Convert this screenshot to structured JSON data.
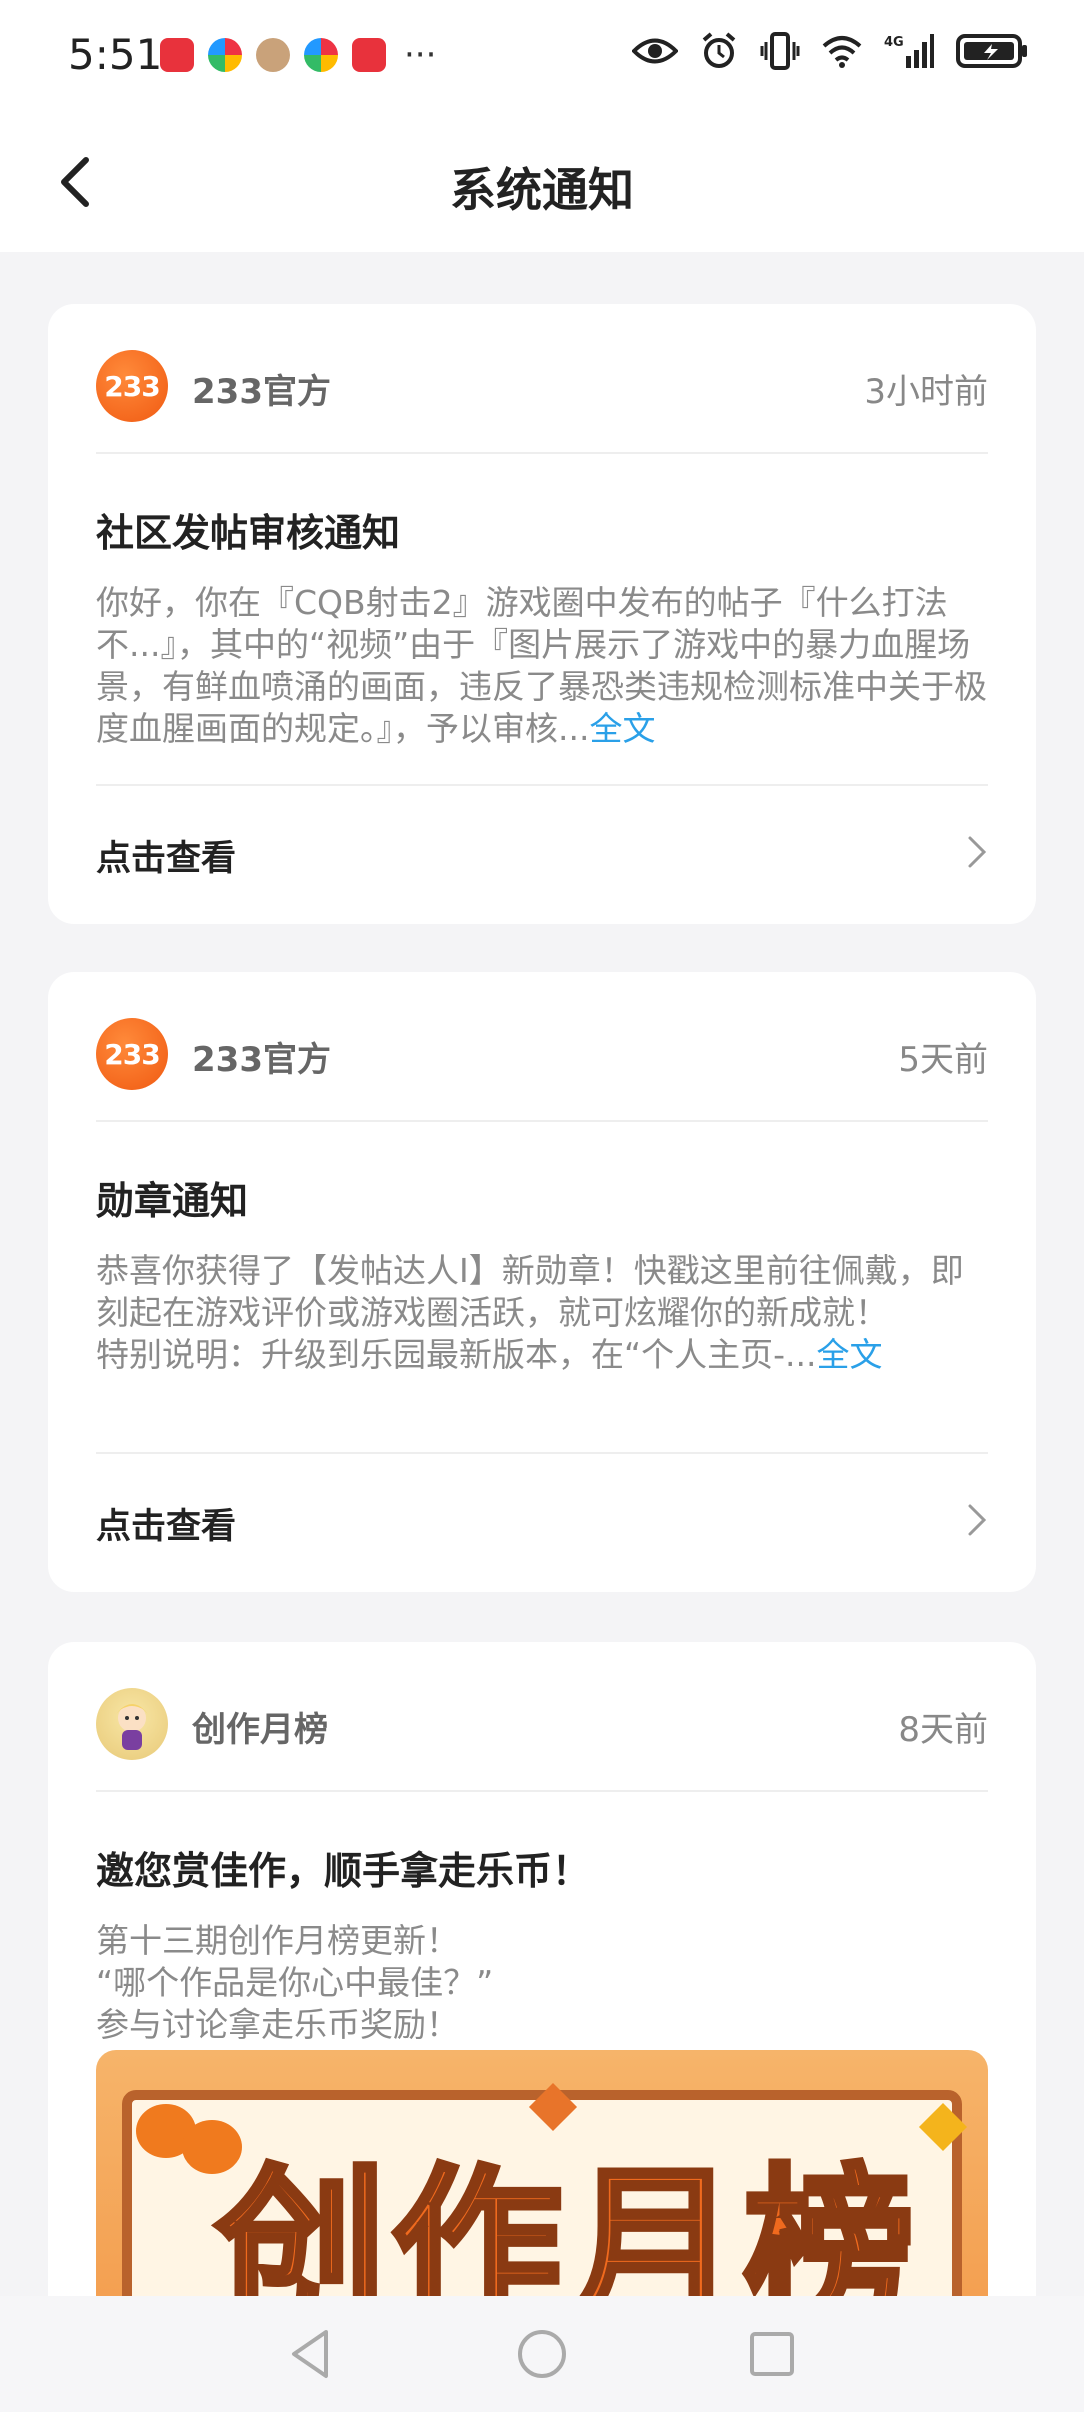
{
  "status_bar": {
    "time": "5:51",
    "more": "···",
    "network": "4G"
  },
  "header": {
    "title": "系统通知",
    "back_icon": "chevron-left-icon"
  },
  "notifications": [
    {
      "source": "233官方",
      "avatar_text": "233",
      "time": "3小时前",
      "title": "社区发帖审核通知",
      "body": "你好，你在『CQB射击2』游戏圈中发布的帖子『什么打法不...』，其中的“视频”由于『图片展示了游戏中的暴力血腥场景，有鲜血喷涌的画面，违反了暴恐类违规检测标准中关于极度血腥画面的规定。』，予以审核...",
      "more": "全文",
      "action": "点击查看"
    },
    {
      "source": "233官方",
      "avatar_text": "233",
      "time": "5天前",
      "title": "勋章通知",
      "body": "恭喜你获得了【发帖达人I】新勋章！快戳这里前往佩戴，即刻起在游戏评价或游戏圈活跃，就可炫耀你的新成就！",
      "body2": "特别说明：升级到乐园最新版本，在“个人主页-...",
      "more": "全文",
      "action": "点击查看"
    },
    {
      "source": "创作月榜",
      "time": "8天前",
      "title": "邀您赏佳作，顺手拿走乐币！",
      "lines": [
        "第十三期创作月榜更新！",
        "“哪个作品是你心中最佳？”",
        "参与讨论拿走乐币奖励！"
      ],
      "banner_text": "创作月榜"
    }
  ],
  "colors": {
    "link": "#2aa0e8",
    "brand_orange": "#f05a12",
    "background": "#f4f4f6"
  }
}
